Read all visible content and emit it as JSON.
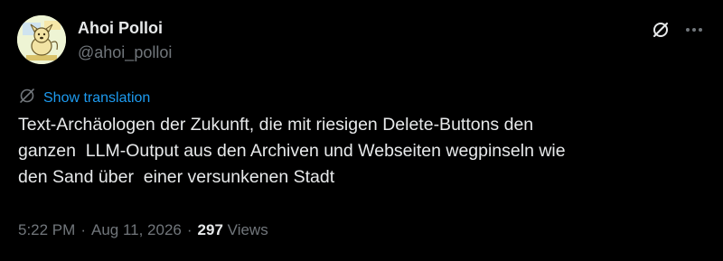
{
  "author": {
    "display_name": "Ahoi Polloi",
    "handle": "@ahoi_polloi",
    "avatar_icon": "cartoon-dog-avatar"
  },
  "actions": {
    "grok_icon": "grok-slash-circle-icon",
    "more_icon": "more-horizontal-icon"
  },
  "translation": {
    "label": "Show translation",
    "icon": "globe-slash-icon"
  },
  "tweet": {
    "text": "Text-Archäologen der Zukunft, die mit riesigen Delete-Buttons den\nganzen  LLM-Output aus den Archiven und Webseiten wegpinseln wie\nden Sand über  einer versunkenen Stadt"
  },
  "meta": {
    "time": "5:22 PM",
    "separator1": "·",
    "date": "Aug 11, 2026",
    "separator2": "·",
    "views_count": "297",
    "views_label": "Views"
  },
  "colors": {
    "background": "#000000",
    "text": "#e7e9ea",
    "secondary": "#71767b",
    "accent": "#1d9bf0"
  }
}
